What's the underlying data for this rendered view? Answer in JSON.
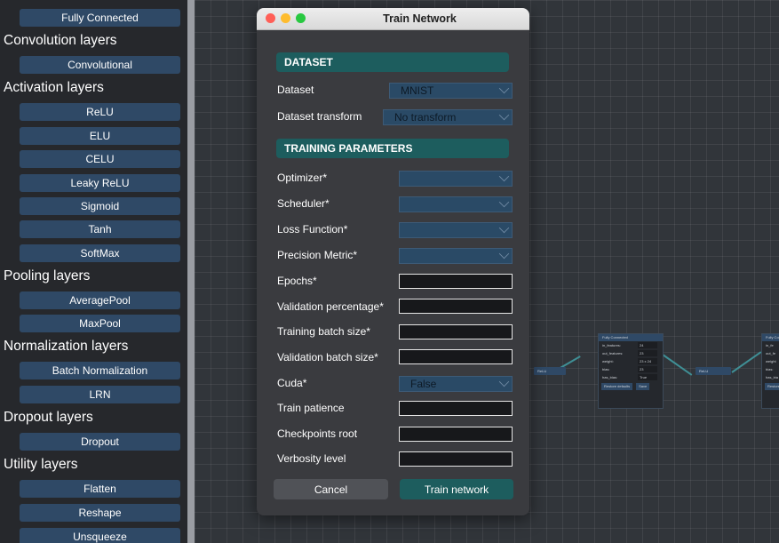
{
  "sidebar": {
    "top_button": "Fully Connected",
    "sections": [
      {
        "title": "Convolution layers",
        "buttons": [
          "Convolutional"
        ]
      },
      {
        "title": "Activation layers",
        "buttons": [
          "ReLU",
          "ELU",
          "CELU",
          "Leaky ReLU",
          "Sigmoid",
          "Tanh",
          "SoftMax"
        ]
      },
      {
        "title": "Pooling layers",
        "buttons": [
          "AveragePool",
          "MaxPool"
        ]
      },
      {
        "title": "Normalization layers",
        "buttons": [
          "Batch Normalization",
          "LRN"
        ]
      },
      {
        "title": "Dropout layers",
        "buttons": [
          "Dropout"
        ]
      },
      {
        "title": "Utility layers",
        "buttons": [
          "Flatten",
          "Reshape",
          "Unsqueeze"
        ]
      }
    ]
  },
  "canvas": {
    "relu_label": "ReLU",
    "node_card": {
      "title": "Fully Connected",
      "fields": [
        {
          "key": "in_features:",
          "value": "24"
        },
        {
          "key": "out_features:",
          "value": "23"
        },
        {
          "key": "weight:",
          "value": "23 x 24"
        },
        {
          "key": "bias:",
          "value": "23"
        },
        {
          "key": "has_bias:",
          "value": "True"
        }
      ],
      "restore_label": "Restore defaults",
      "save_label": "Save"
    },
    "partial_card": {
      "title": "Fully Conn",
      "fields": [
        "in_fe",
        "out_fe",
        "weight",
        "bias:",
        "has_bia"
      ],
      "restore_label": "Restore"
    }
  },
  "dialog": {
    "title": "Train Network",
    "dataset_header": "DATASET",
    "dataset_label": "Dataset",
    "dataset_value": "MNIST",
    "transform_label": "Dataset transform",
    "transform_value": "No transform",
    "training_header": "TRAINING PARAMETERS",
    "select_fields": [
      {
        "label": "Optimizer*",
        "value": ""
      },
      {
        "label": "Scheduler*",
        "value": ""
      },
      {
        "label": "Loss Function*",
        "value": ""
      },
      {
        "label": "Precision Metric*",
        "value": ""
      }
    ],
    "text_fields_1": [
      {
        "label": "Epochs*",
        "value": ""
      },
      {
        "label": "Validation percentage*",
        "value": ""
      },
      {
        "label": "Training batch size*",
        "value": ""
      },
      {
        "label": "Validation batch size*",
        "value": ""
      }
    ],
    "cuda_label": "Cuda*",
    "cuda_value": "False",
    "text_fields_2": [
      {
        "label": "Train patience",
        "value": ""
      },
      {
        "label": "Checkpoints root",
        "value": ""
      },
      {
        "label": "Verbosity level",
        "value": ""
      }
    ],
    "cancel_label": "Cancel",
    "train_label": "Train network"
  },
  "colors": {
    "accent_teal": "#1d5d5e",
    "layer_button": "#2f4966",
    "cancel_button": "#505257",
    "traffic_red": "#ff5f57",
    "traffic_yellow": "#febc2e",
    "traffic_green": "#28c840"
  }
}
